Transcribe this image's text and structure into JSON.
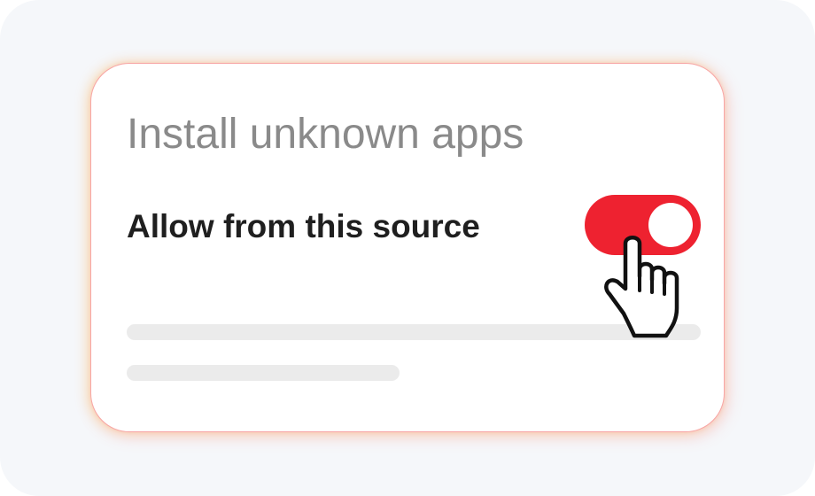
{
  "card": {
    "title": "Install unknown apps",
    "setting": {
      "label": "Allow from this source",
      "toggle_state": "on",
      "toggle_color": "#ee2230"
    }
  },
  "colors": {
    "background": "#f5f7fa",
    "card_border": "#f7a5a5",
    "title_text": "#8a8a8a",
    "label_text": "#1f1f1f",
    "placeholder": "#ebebeb"
  },
  "icons": {
    "cursor": "hand-pointer-icon"
  }
}
